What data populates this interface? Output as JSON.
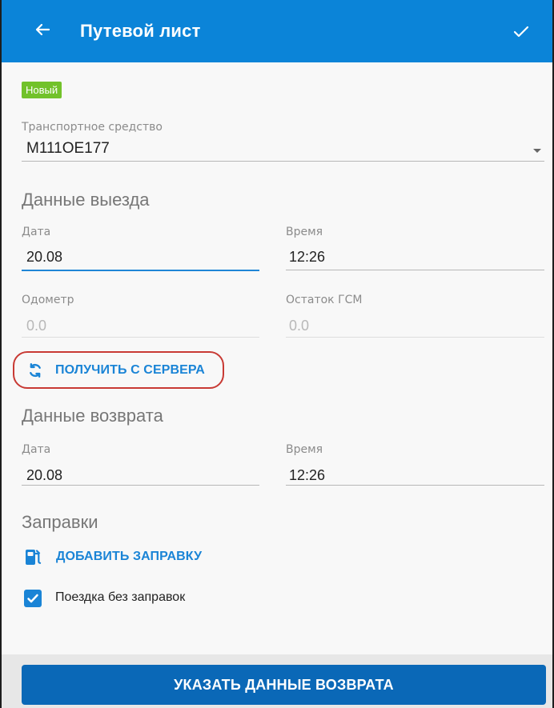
{
  "header": {
    "title": "Путевой лист"
  },
  "status_badge": "Новый",
  "vehicle": {
    "label": "Транспортное средство",
    "value": "М111ОЕ177"
  },
  "departure": {
    "section_title": "Данные выезда",
    "date_label": "Дата",
    "date_value": "20.08",
    "time_label": "Время",
    "time_value": "12:26",
    "odometer_label": "Одометр",
    "odometer_value": "0.0",
    "fuel_label": "Остаток ГСМ",
    "fuel_value": "0.0",
    "fetch_button": "ПОЛУЧИТЬ С СЕРВЕРА"
  },
  "return": {
    "section_title": "Данные возврата",
    "date_label": "Дата",
    "date_value": "20.08",
    "time_label": "Время",
    "time_value": "12:26"
  },
  "refuels": {
    "section_title": "Заправки",
    "add_button": "ДОБАВИТЬ ЗАПРАВКУ",
    "no_refuel_label": "Поездка без заправок",
    "no_refuel_checked": true
  },
  "footer": {
    "return_button": "УКАЗАТЬ ДАННЫЕ ВОЗВРАТА"
  },
  "colors": {
    "primary": "#0b84d8",
    "accent": "#1a84d6",
    "badge": "#72c22a",
    "highlight": "#c83a34",
    "button": "#0a68b7"
  },
  "icons": {
    "back": "back-arrow-icon",
    "save": "checkmark-icon",
    "dropdown": "chevron-down-icon",
    "refresh": "refresh-icon",
    "fuel": "fuel-pump-icon",
    "checkbox": "checkbox-checked-icon"
  }
}
